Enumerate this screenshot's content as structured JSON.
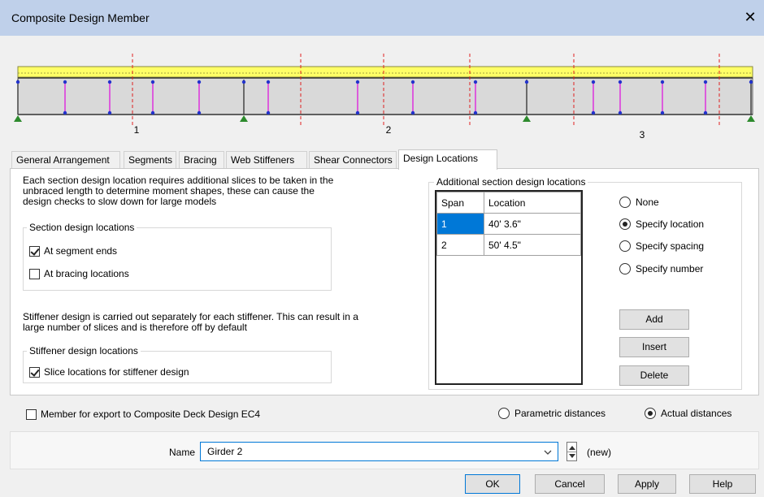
{
  "window": {
    "title": "Composite Design Member",
    "close_glyph": "✕"
  },
  "diagram": {
    "span_labels": [
      "1",
      "2",
      "3"
    ]
  },
  "tabs": [
    {
      "label": "General Arrangement",
      "active": false
    },
    {
      "label": "Segments",
      "active": false
    },
    {
      "label": "Bracing",
      "active": false
    },
    {
      "label": "Web Stiffeners",
      "active": false
    },
    {
      "label": "Shear Connectors",
      "active": false
    },
    {
      "label": "Design Locations",
      "active": true
    }
  ],
  "design_locations": {
    "intro_text": "Each section design location requires additional slices to be taken in the unbraced length to determine moment shapes, these can cause the design checks to slow down for large models",
    "section_group": {
      "title": "Section design locations",
      "at_segment_ends": {
        "label": "At segment ends",
        "checked": true
      },
      "at_bracing_locations": {
        "label": "At bracing locations",
        "checked": false
      }
    },
    "stiffener_text": "Stiffener design is carried out separately for each stiffener. This can result in a large number of slices and is therefore off by default",
    "stiffener_group": {
      "title": "Stiffener design locations",
      "slice_locations": {
        "label": "Slice locations for stiffener design",
        "checked": true
      }
    },
    "additional_group": {
      "title": "Additional section design locations",
      "columns": [
        "Span",
        "Location"
      ],
      "rows": [
        {
          "span": "1",
          "location": "40' 3.6\""
        },
        {
          "span": "2",
          "location": "50' 4.5\""
        }
      ],
      "options": [
        {
          "label": "None",
          "checked": false
        },
        {
          "label": "Specify location",
          "checked": true
        },
        {
          "label": "Specify spacing",
          "checked": false
        },
        {
          "label": "Specify number",
          "checked": false
        }
      ],
      "buttons": {
        "add": "Add",
        "insert": "Insert",
        "delete": "Delete"
      }
    }
  },
  "bottom": {
    "export_checkbox": {
      "label": "Member for export to Composite Deck Design EC4",
      "checked": false
    },
    "parametric": {
      "label": "Parametric distances",
      "checked": false
    },
    "actual": {
      "label": "Actual distances",
      "checked": true
    }
  },
  "name_row": {
    "label": "Name",
    "value": "Girder 2",
    "status": "(new)"
  },
  "footer_buttons": {
    "ok": "OK",
    "cancel": "Cancel",
    "apply": "Apply",
    "help": "Help"
  }
}
